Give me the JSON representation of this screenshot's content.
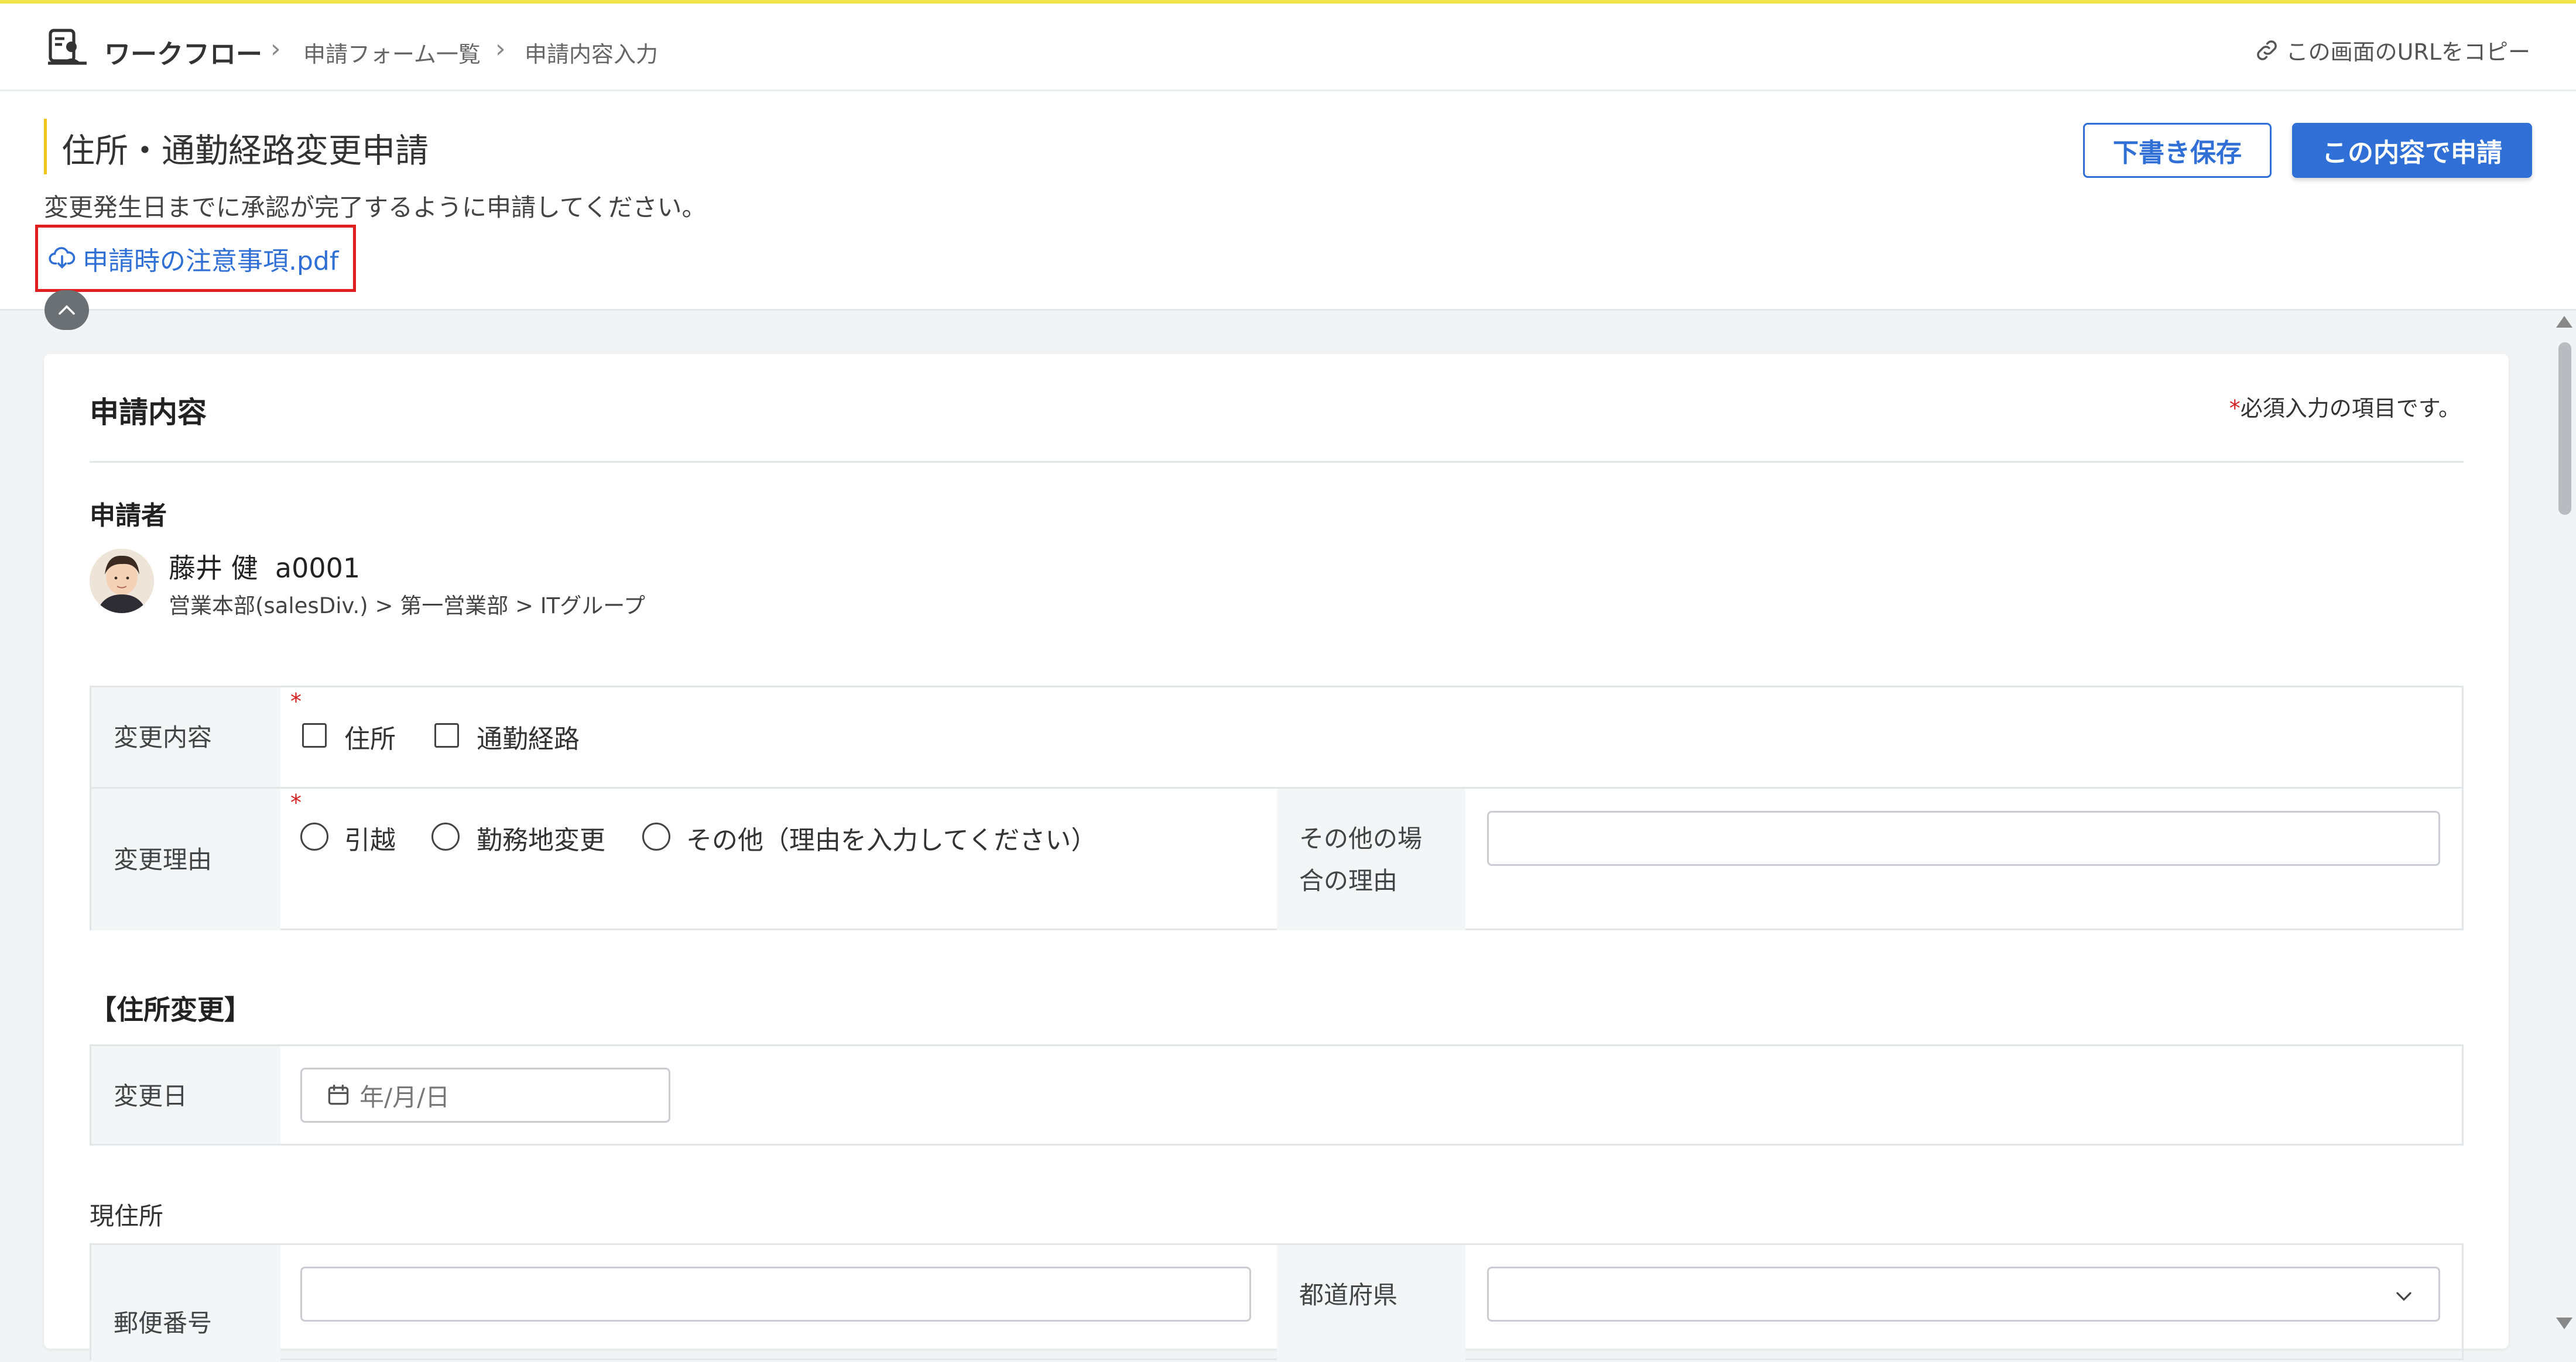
{
  "colors": {
    "accent": "#2f6fd6",
    "required": "#d32020",
    "highlight_border": "#e02020",
    "title_accent": "#f0c419"
  },
  "header": {
    "app_name": "ワークフロー",
    "breadcrumbs": [
      "申請フォーム一覧",
      "申請内容入力"
    ],
    "copy_url": "この画面のURLをコピー"
  },
  "page": {
    "title": "住所・通勤経路変更申請",
    "description": "変更発生日までに承認が完了するように申請してください。",
    "attachment": "申請時の注意事項.pdf",
    "draft_button": "下書き保存",
    "submit_button": "この内容で申請"
  },
  "form": {
    "section_title": "申請内容",
    "required_mark": "*",
    "required_note": "必須入力の項目です。",
    "applicant_label": "申請者",
    "applicant": {
      "name": "藤井 健",
      "id": "a0001",
      "org": "営業本部(salesDiv.) > 第一営業部 > ITグループ"
    },
    "change_content": {
      "label": "変更内容",
      "options": [
        "住所",
        "通勤経路"
      ]
    },
    "change_reason": {
      "label": "変更理由",
      "options": [
        "引越",
        "勤務地変更",
        "その他（理由を入力してください）"
      ],
      "other_label_line1": "その他の場",
      "other_label_line2": "合の理由",
      "other_value": ""
    },
    "address_section": {
      "title": "【住所変更】",
      "change_date_label": "変更日",
      "change_date_placeholder": "年/月/日"
    },
    "current_address": {
      "label": "現住所",
      "postal_label": "郵便番号",
      "postal_value": "",
      "prefecture_label": "都道府県",
      "prefecture_value": ""
    }
  }
}
